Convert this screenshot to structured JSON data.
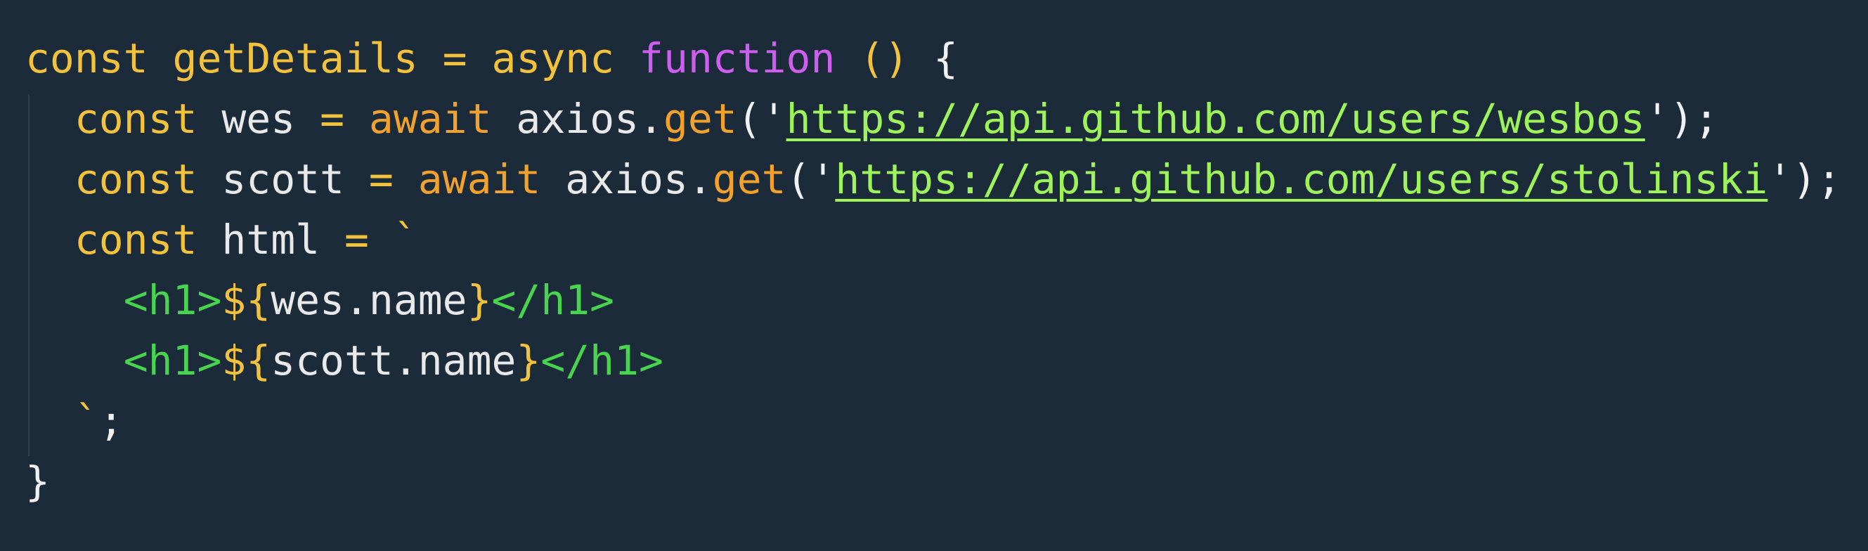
{
  "code": {
    "lines": [
      {
        "tokens": [
          {
            "text": "const",
            "kind": "kw"
          },
          {
            "text": " ",
            "kind": "ident"
          },
          {
            "text": "getDetails",
            "kind": "kw"
          },
          {
            "text": " ",
            "kind": "ident"
          },
          {
            "text": "=",
            "kind": "op"
          },
          {
            "text": " ",
            "kind": "ident"
          },
          {
            "text": "async",
            "kind": "kw"
          },
          {
            "text": " ",
            "kind": "ident"
          },
          {
            "text": "function",
            "kind": "fn"
          },
          {
            "text": " ",
            "kind": "ident"
          },
          {
            "text": "()",
            "kind": "kw"
          },
          {
            "text": " ",
            "kind": "ident"
          },
          {
            "text": "{",
            "kind": "brace"
          }
        ]
      },
      {
        "tokens": [
          {
            "text": "  ",
            "kind": "ident"
          },
          {
            "text": "const",
            "kind": "kw"
          },
          {
            "text": " wes ",
            "kind": "ident"
          },
          {
            "text": "=",
            "kind": "op"
          },
          {
            "text": " ",
            "kind": "ident"
          },
          {
            "text": "await",
            "kind": "call"
          },
          {
            "text": " axios.",
            "kind": "ident"
          },
          {
            "text": "get",
            "kind": "call"
          },
          {
            "text": "('",
            "kind": "punct"
          },
          {
            "text": "https://api.github.com/users/wesbos",
            "kind": "str"
          },
          {
            "text": "');",
            "kind": "punct"
          }
        ]
      },
      {
        "tokens": [
          {
            "text": "  ",
            "kind": "ident"
          },
          {
            "text": "const",
            "kind": "kw"
          },
          {
            "text": " scott ",
            "kind": "ident"
          },
          {
            "text": "=",
            "kind": "op"
          },
          {
            "text": " ",
            "kind": "ident"
          },
          {
            "text": "await",
            "kind": "call"
          },
          {
            "text": " axios.",
            "kind": "ident"
          },
          {
            "text": "get",
            "kind": "call"
          },
          {
            "text": "('",
            "kind": "punct"
          },
          {
            "text": "https://api.github.com/users/stolinski",
            "kind": "str"
          },
          {
            "text": "');",
            "kind": "punct"
          }
        ]
      },
      {
        "tokens": [
          {
            "text": "  ",
            "kind": "ident"
          },
          {
            "text": "const",
            "kind": "kw"
          },
          {
            "text": " html ",
            "kind": "ident"
          },
          {
            "text": "=",
            "kind": "op"
          },
          {
            "text": " `",
            "kind": "op"
          }
        ]
      },
      {
        "tokens": [
          {
            "text": "    ",
            "kind": "ident"
          },
          {
            "text": "<h1>",
            "kind": "tag"
          },
          {
            "text": "${",
            "kind": "interp"
          },
          {
            "text": "wes.name",
            "kind": "ident"
          },
          {
            "text": "}",
            "kind": "interp"
          },
          {
            "text": "</h1>",
            "kind": "tag"
          }
        ]
      },
      {
        "tokens": [
          {
            "text": "    ",
            "kind": "ident"
          },
          {
            "text": "<h1>",
            "kind": "tag"
          },
          {
            "text": "${",
            "kind": "interp"
          },
          {
            "text": "scott.name",
            "kind": "ident"
          },
          {
            "text": "}",
            "kind": "interp"
          },
          {
            "text": "</h1>",
            "kind": "tag"
          }
        ]
      },
      {
        "tokens": [
          {
            "text": "  ",
            "kind": "ident"
          },
          {
            "text": "`",
            "kind": "op"
          },
          {
            "text": ";",
            "kind": "punct"
          }
        ]
      },
      {
        "tokens": [
          {
            "text": "}",
            "kind": "brace"
          }
        ]
      }
    ]
  }
}
